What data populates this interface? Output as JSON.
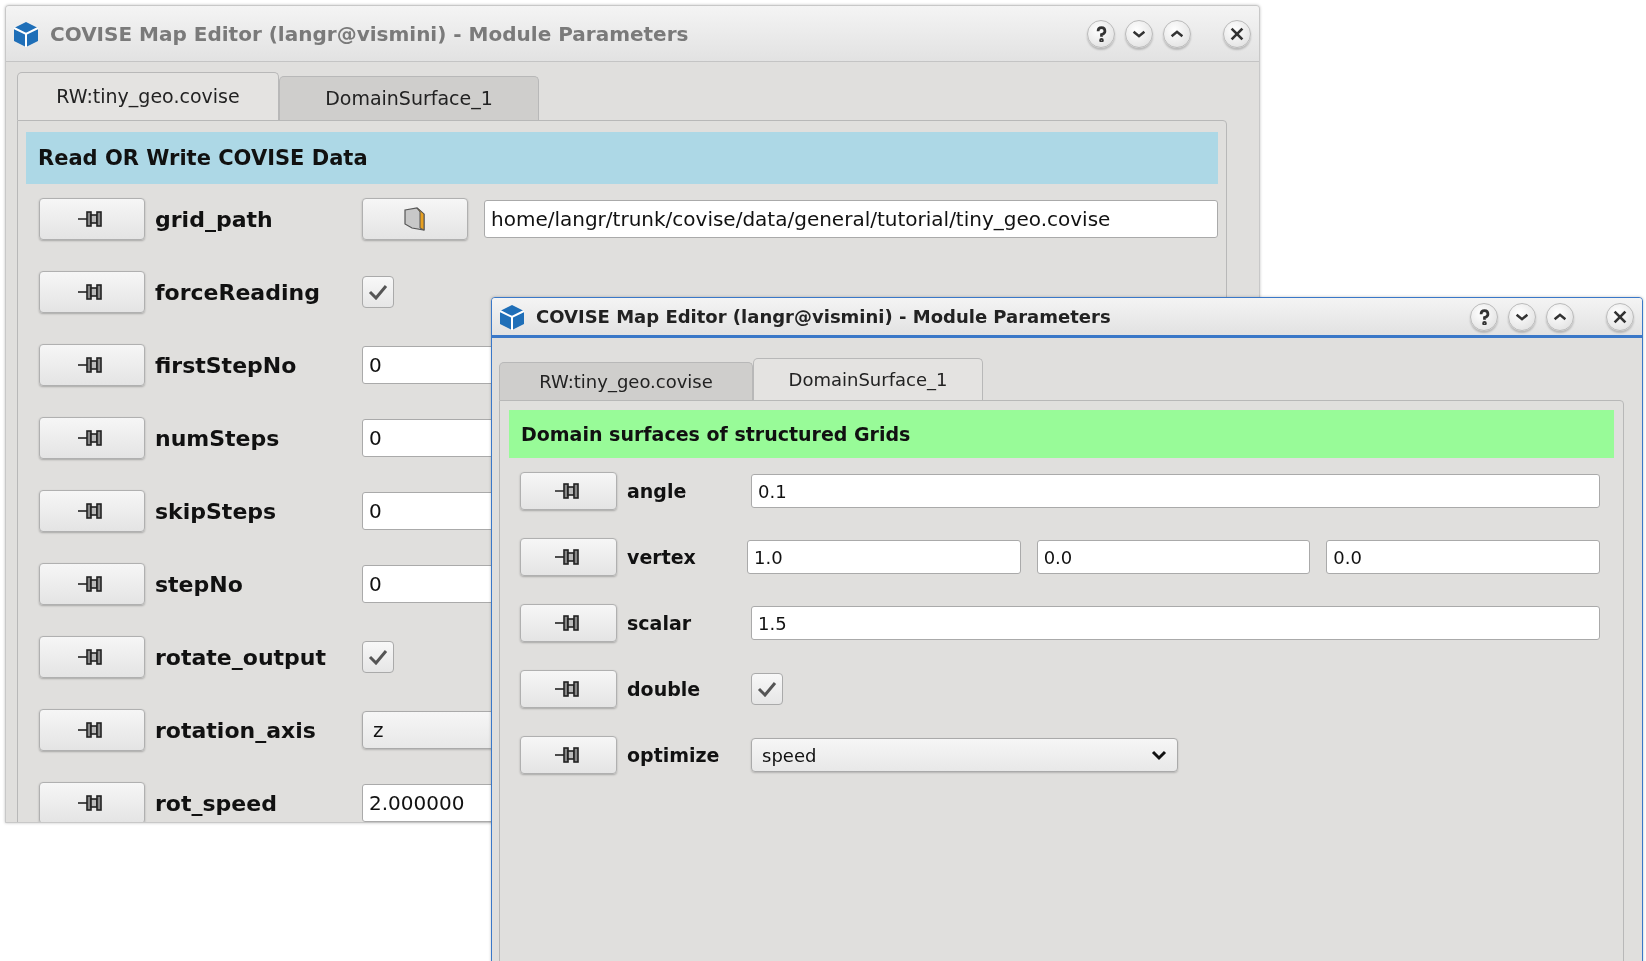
{
  "windows": [
    {
      "title": "COVISE Map Editor (langr@vismini) - Module Parameters",
      "active": false,
      "tabs": [
        {
          "label": "RW:tiny_geo.covise",
          "selected": true
        },
        {
          "label": "DomainSurface_1",
          "selected": false
        }
      ],
      "header": {
        "text": "Read OR Write COVISE Data",
        "color": "#add8e6"
      },
      "params": [
        {
          "kind": "file",
          "name": "grid_path",
          "value": "home/langr/trunk/covise/data/general/tutorial/tiny_geo.covise"
        },
        {
          "kind": "checkbox",
          "name": "forceReading",
          "checked": true
        },
        {
          "kind": "field",
          "name": "firstStepNo",
          "value": "0"
        },
        {
          "kind": "field",
          "name": "numSteps",
          "value": "0"
        },
        {
          "kind": "field",
          "name": "skipSteps",
          "value": "0"
        },
        {
          "kind": "field",
          "name": "stepNo",
          "value": "0"
        },
        {
          "kind": "checkbox",
          "name": "rotate_output",
          "checked": true
        },
        {
          "kind": "choice",
          "name": "rotation_axis",
          "value": "z"
        },
        {
          "kind": "field",
          "name": "rot_speed",
          "value": "2.000000"
        }
      ]
    },
    {
      "title": "COVISE Map Editor (langr@vismini) - Module Parameters",
      "active": true,
      "tabs": [
        {
          "label": "RW:tiny_geo.covise",
          "selected": false
        },
        {
          "label": "DomainSurface_1",
          "selected": true
        }
      ],
      "header": {
        "text": "Domain surfaces of structured Grids",
        "color": "#98fb98"
      },
      "params": [
        {
          "kind": "field",
          "name": "angle",
          "value": "0.1"
        },
        {
          "kind": "vector",
          "name": "vertex",
          "values": [
            "1.0",
            "0.0",
            "0.0"
          ]
        },
        {
          "kind": "field",
          "name": "scalar",
          "value": "1.5"
        },
        {
          "kind": "checkbox",
          "name": "double",
          "checked": true
        },
        {
          "kind": "choice",
          "name": "optimize",
          "value": "speed"
        }
      ]
    }
  ]
}
